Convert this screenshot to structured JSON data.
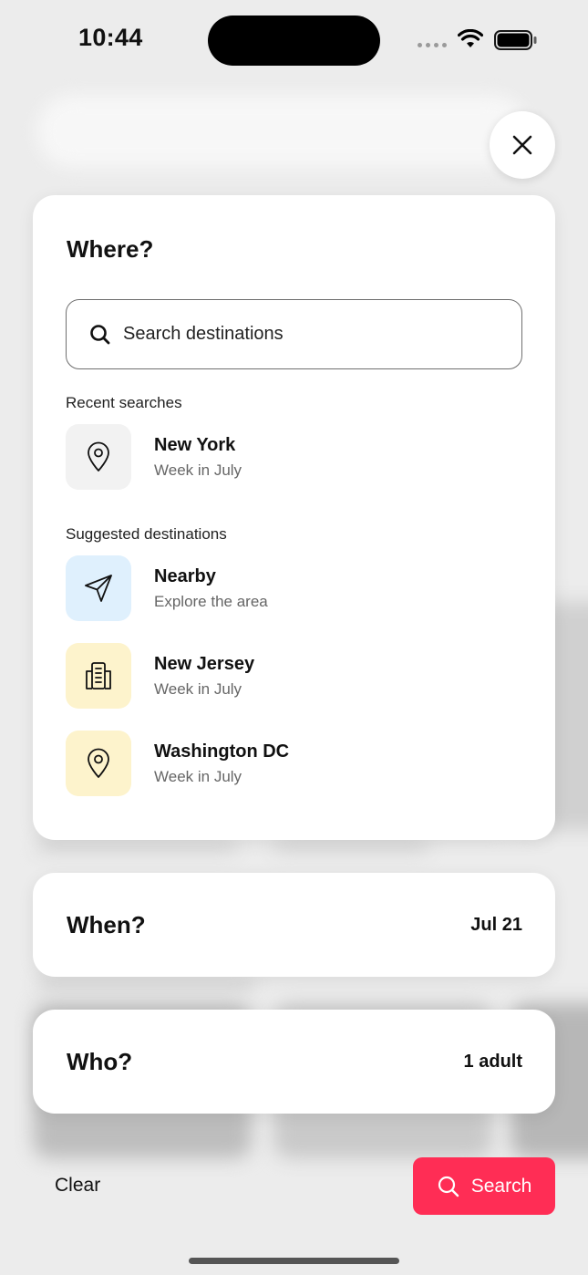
{
  "status": {
    "time": "10:44"
  },
  "where": {
    "title": "Where?",
    "search_placeholder": "Search destinations",
    "recent_label": "Recent searches",
    "recent": [
      {
        "name": "New York",
        "subtitle": "Week in July",
        "icon": "location-pin-icon"
      }
    ],
    "suggested_label": "Suggested destinations",
    "suggested": [
      {
        "name": "Nearby",
        "subtitle": "Explore the area",
        "icon": "navigation-arrow-icon"
      },
      {
        "name": "New Jersey",
        "subtitle": "Week in July",
        "icon": "building-icon"
      },
      {
        "name": "Washington DC",
        "subtitle": "Week in July",
        "icon": "location-pin-icon"
      }
    ]
  },
  "when": {
    "title": "When?",
    "value": "Jul 21"
  },
  "who": {
    "title": "Who?",
    "value": "1 adult"
  },
  "footer": {
    "clear_label": "Clear",
    "search_label": "Search"
  },
  "colors": {
    "accent": "#ff2d55",
    "recent_icon_bg": "#f2f2f2",
    "nearby_icon_bg": "#dff0fd",
    "suggested_icon_bg": "#fdf3cc"
  }
}
